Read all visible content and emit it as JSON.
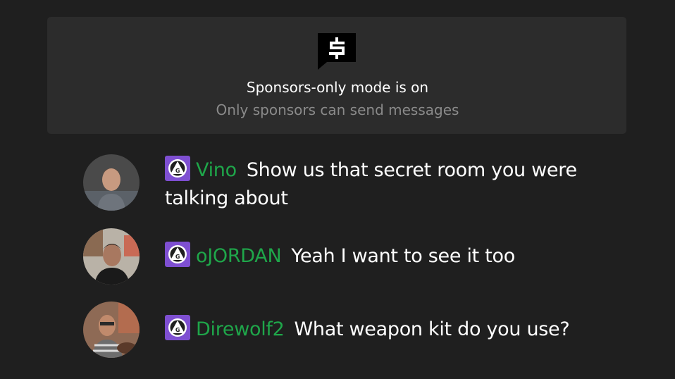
{
  "banner": {
    "icon": "sponsor-dollar-icon",
    "title": "Sponsors-only mode is on",
    "subtitle": "Only sponsors can send messages"
  },
  "messages": [
    {
      "username": "Vino",
      "text": "Show us that secret room you were talking about",
      "badge": "sponsor-badge-icon"
    },
    {
      "username": "oJORDAN",
      "text": "Yeah I want to see it too",
      "badge": "sponsor-badge-icon"
    },
    {
      "username": "Direwolf2",
      "text": "What weapon kit do you use?",
      "badge": "sponsor-badge-icon"
    }
  ],
  "colors": {
    "background": "#1f1f1f",
    "banner": "#2c2c2c",
    "username": "#1fa64a",
    "badge": "#7e4fd1",
    "subtitle": "#8a8a8a"
  }
}
